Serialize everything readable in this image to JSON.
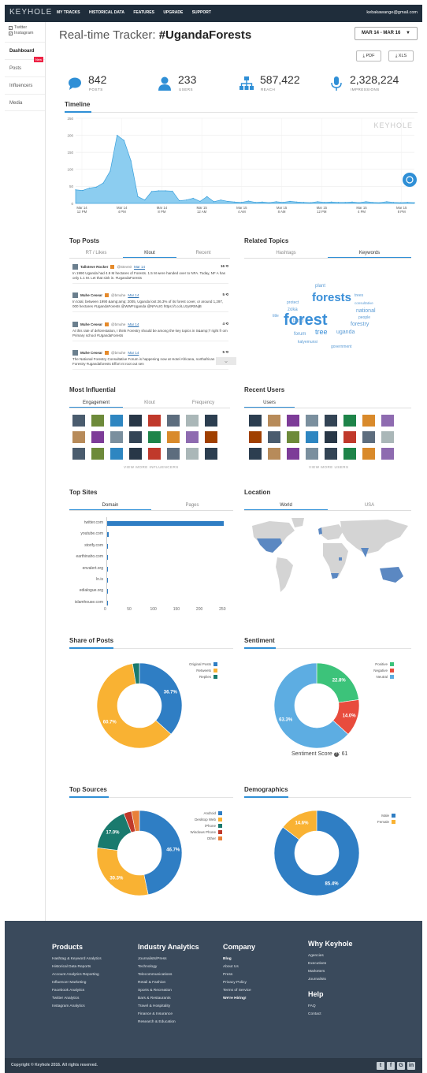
{
  "app": {
    "logo": "KEYHOLE",
    "nav": [
      "MY TRACKS",
      "HISTORICAL DATA",
      "FEATURES",
      "UPGRADE",
      "SUPPORT"
    ],
    "user_email": "kebakawange@gmail.com"
  },
  "sidebar": {
    "filters": [
      {
        "label": "Twitter",
        "checked": true
      },
      {
        "label": "Instagram",
        "checked": true
      }
    ],
    "items": [
      {
        "label": "Dashboard",
        "active": true
      },
      {
        "label": "Posts",
        "badge": "New"
      },
      {
        "label": "Influencers"
      },
      {
        "label": "Media"
      }
    ]
  },
  "header": {
    "title_prefix": "Real-time Tracker: ",
    "title_tag": "#UgandaForests",
    "date_range": "MAR 14 - MAR 16",
    "export_pdf": "PDF",
    "export_xls": "XLS"
  },
  "stats": [
    {
      "value": "842",
      "label": "POSTS",
      "icon": "speech-bubble-icon"
    },
    {
      "value": "233",
      "label": "USERS",
      "icon": "user-icon"
    },
    {
      "value": "587,422",
      "label": "REACH",
      "icon": "network-icon"
    },
    {
      "value": "2,328,224",
      "label": "IMPRESSIONS",
      "icon": "microphone-icon"
    }
  ],
  "timeline": {
    "heading": "Timeline",
    "watermark": "KEYHOLE",
    "y_ticks": [
      "250",
      "200",
      "150",
      "100",
      "50",
      "0"
    ],
    "x_ticks": [
      {
        "d": "Mar 14",
        "t": "12 PM"
      },
      {
        "d": "Mar 14",
        "t": "4 PM"
      },
      {
        "d": "Mar 14",
        "t": "8 PM"
      },
      {
        "d": "Mar 15",
        "t": "12 AM"
      },
      {
        "d": "Mar 15",
        "t": "4 AM"
      },
      {
        "d": "Mar 15",
        "t": "8 AM"
      },
      {
        "d": "Mar 15",
        "t": "12 PM"
      },
      {
        "d": "Mar 15",
        "t": "4 PM"
      },
      {
        "d": "Mar 15",
        "t": "8 PM"
      }
    ]
  },
  "top_posts": {
    "heading": "Top Posts",
    "tabs": [
      "RT / Likes",
      "Klout",
      "Recent"
    ],
    "posts": [
      {
        "name": "Tallsteve Rocker",
        "handle": "@Stevn0",
        "date": "Mar 14",
        "score": "16",
        "text": "In 1990 Uganda had 4.9 M hectares of Forests. 1.5 M were handed over to NFA. Today, NF A has only 1.1 M. Let that sink in. #UgandaForests"
      },
      {
        "name": "Muhe Cesear",
        "handle": "@bmuhe",
        "date": "Mar 14",
        "score": "5",
        "text": "In total, between 1990 &amp;amp; 2005, Uganda lost 26.3% of its forest cover, or around 1,297, 000 hectares #UgandaForests @WWFUganda @NFAUG https://t.co/LUzy6R5NjB"
      },
      {
        "name": "Muhe Cesear",
        "handle": "@bmuhe",
        "date": "Mar 14",
        "score": "4",
        "text": "At this rate of deforestation, I think Forestry should be among the key topics in S&amp;T right fr om Primary school #UgandaForests"
      },
      {
        "name": "Muhe Cesear",
        "handle": "@bmuhe",
        "date": "Mar 14",
        "score": "5",
        "text": "The National Forestry Consultative Forum is happening now at Hotel Africana, northafrican Forestry #ugandaforests Effort nt root out sen"
      }
    ]
  },
  "related_topics": {
    "heading": "Related Topics",
    "tabs": [
      "Hashtags",
      "Keywords"
    ],
    "words": [
      "forest",
      "forests",
      "land",
      "tree",
      "zoka",
      "uganda",
      "national",
      "forestry",
      "consultative",
      "people",
      "plant",
      "trees",
      "protect",
      "forum",
      "kalyemunsi",
      "government",
      "title"
    ]
  },
  "most_influential": {
    "heading": "Most Influential",
    "tabs": [
      "Engagement",
      "Klout",
      "Frequency"
    ],
    "view_more": "VIEW MORE INFLUENCERS"
  },
  "recent_users": {
    "heading": "Recent Users",
    "tabs": [
      "Users"
    ],
    "view_more": "VIEW MORE USERS"
  },
  "top_sites": {
    "heading": "Top Sites",
    "tabs": [
      "Domain",
      "Pages"
    ]
  },
  "location": {
    "heading": "Location",
    "tabs": [
      "World",
      "USA"
    ]
  },
  "share_of_posts": {
    "heading": "Share of Posts",
    "legend": [
      {
        "label": "Original Posts",
        "color": "#2f7ec4"
      },
      {
        "label": "Retweets",
        "color": "#f9b233"
      },
      {
        "label": "Replies",
        "color": "#1a7a6e"
      }
    ]
  },
  "sentiment": {
    "heading": "Sentiment",
    "legend": [
      {
        "label": "Positive",
        "color": "#3cc37a"
      },
      {
        "label": "Negative",
        "color": "#e84c3d"
      },
      {
        "label": "Neutral",
        "color": "#5dade2"
      }
    ],
    "score_label": "Sentiment Score",
    "score_value": "61"
  },
  "top_sources": {
    "heading": "Top Sources",
    "legend": [
      {
        "label": "Android",
        "color": "#2f7ec4"
      },
      {
        "label": "Desktop Web",
        "color": "#f9b233"
      },
      {
        "label": "iPhone",
        "color": "#1a7a6e"
      },
      {
        "label": "Windows Phone",
        "color": "#c0392b"
      },
      {
        "label": "Other",
        "color": "#e8803a"
      }
    ]
  },
  "demographics": {
    "heading": "Demographics",
    "legend": [
      {
        "label": "Male",
        "color": "#2f7ec4"
      },
      {
        "label": "Female",
        "color": "#f9b233"
      }
    ]
  },
  "chart_data": [
    {
      "type": "area",
      "title": "Timeline",
      "ylim": [
        0,
        250
      ],
      "x_ticks": [
        "Mar 14 12 PM",
        "Mar 14 4 PM",
        "Mar 14 8 PM",
        "Mar 15 12 AM",
        "Mar 15 4 AM",
        "Mar 15 8 AM",
        "Mar 15 12 PM",
        "Mar 15 4 PM",
        "Mar 15 8 PM"
      ],
      "values": [
        40,
        38,
        45,
        48,
        60,
        95,
        200,
        185,
        125,
        20,
        10,
        35,
        37,
        37,
        36,
        8,
        10,
        15,
        6,
        20,
        5,
        10,
        6,
        4,
        3,
        7,
        3,
        4,
        2,
        5,
        3,
        6,
        4,
        3,
        2,
        5,
        3,
        4,
        3,
        3,
        4,
        2,
        5,
        3,
        2,
        5,
        3,
        2,
        3,
        2
      ],
      "grid": true
    },
    {
      "type": "bar",
      "title": "Top Sites",
      "categories": [
        "twitter.com",
        "youtube.com",
        "storify.com",
        "earthinaho.com",
        "envalert.org",
        "ln.is",
        "edialogue.org",
        "islamhouse.com"
      ],
      "values": [
        255,
        5,
        3,
        2,
        2,
        1,
        1,
        1
      ],
      "xlim": [
        0,
        260
      ],
      "x_ticks": [
        "0",
        "50",
        "100",
        "150",
        "200",
        "250"
      ]
    },
    {
      "type": "pie",
      "title": "Share of Posts",
      "labels": [
        "Original Posts",
        "Retweets",
        "Replies"
      ],
      "values": [
        36.7,
        60.7,
        2.6
      ],
      "colors": [
        "#2f7ec4",
        "#f9b233",
        "#1a7a6e"
      ],
      "data_labels": [
        "36.7%",
        "60.7%",
        ""
      ]
    },
    {
      "type": "pie",
      "title": "Sentiment",
      "labels": [
        "Positive",
        "Negative",
        "Neutral"
      ],
      "values": [
        22.8,
        14.0,
        63.3
      ],
      "colors": [
        "#3cc37a",
        "#e84c3d",
        "#5dade2"
      ],
      "data_labels": [
        "22.8%",
        "14.0%",
        "63.3%"
      ]
    },
    {
      "type": "pie",
      "title": "Top Sources",
      "labels": [
        "Android",
        "Desktop Web",
        "iPhone",
        "Windows Phone",
        "Other"
      ],
      "values": [
        46.7,
        30.3,
        17.0,
        3.0,
        3.0
      ],
      "colors": [
        "#2f7ec4",
        "#f9b233",
        "#1a7a6e",
        "#c0392b",
        "#e8803a"
      ],
      "data_labels": [
        "46.7%",
        "30.3%",
        "17.0%",
        "",
        ""
      ]
    },
    {
      "type": "pie",
      "title": "Demographics",
      "labels": [
        "Male",
        "Female"
      ],
      "values": [
        85.4,
        14.6
      ],
      "colors": [
        "#2f7ec4",
        "#f9b233"
      ],
      "data_labels": [
        "85.4%",
        "14.6%"
      ]
    }
  ],
  "footer": {
    "columns": [
      {
        "heading": "Products",
        "items": [
          "Hashtag & Keyword Analytics",
          "Historical Data Reports",
          "Account Analytics Reporting",
          "Influencer Marketing",
          "Facebook Analytics",
          "Twitter Analytics",
          "Instagram Analytics"
        ]
      },
      {
        "heading": "Industry Analytics",
        "items": [
          "Journalists/Press",
          "Technology",
          "Telecommunications",
          "Retail & Fashion",
          "Sports & Recreation",
          "Bars & Restaurants",
          "Travel & Hospitality",
          "Finance & Insurance",
          "Research & Education"
        ]
      },
      {
        "heading": "Company",
        "items": [
          "Blog",
          "About Us",
          "Press",
          "Privacy Policy",
          "Terms of Service",
          "We're Hiring!"
        ]
      },
      {
        "heading": "Why Keyhole",
        "items": [
          "Agencies",
          "Executives",
          "Marketers",
          "Journalists"
        ]
      },
      {
        "heading": "Help",
        "items": [
          "FAQ",
          "Contact"
        ]
      }
    ],
    "copyright": "Copyright © Keyhole 2016. All rights reserved.",
    "social": [
      "twitter-icon",
      "facebook-icon",
      "google-plus-icon",
      "linkedin-icon"
    ]
  }
}
